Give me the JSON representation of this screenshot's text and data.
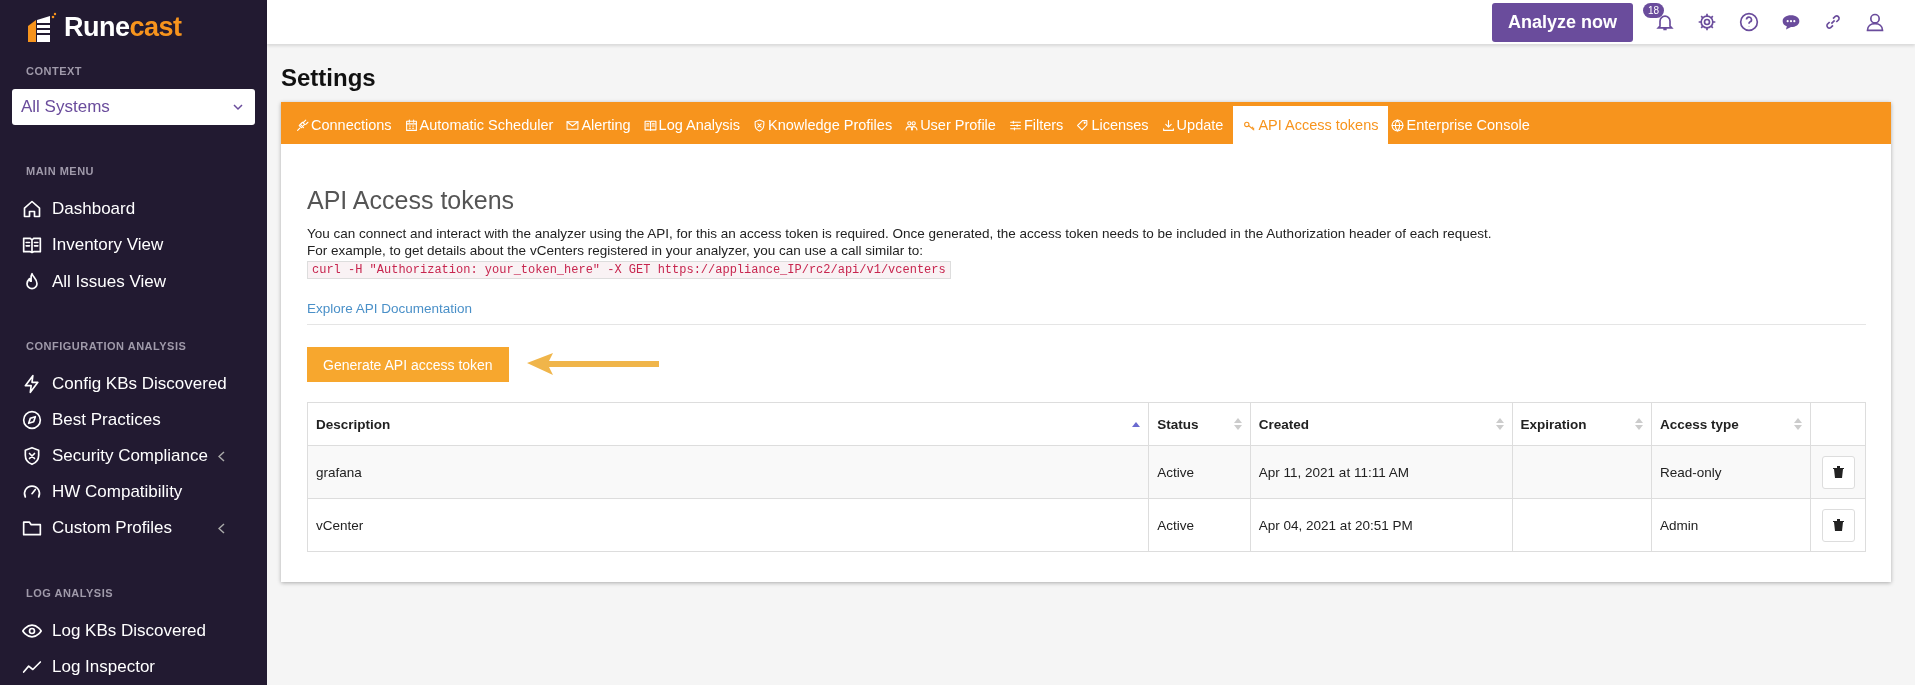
{
  "brand": {
    "name_part1": "Rune",
    "name_part2": "cast"
  },
  "sidebar": {
    "context_label": "CONTEXT",
    "context_select": {
      "value": "All Systems"
    },
    "sections": [
      {
        "heading": "MAIN MENU",
        "items": [
          {
            "label": "Dashboard",
            "expandable": false
          },
          {
            "label": "Inventory View",
            "expandable": false
          },
          {
            "label": "All Issues View",
            "expandable": false
          }
        ]
      },
      {
        "heading": "CONFIGURATION ANALYSIS",
        "items": [
          {
            "label": "Config KBs Discovered",
            "expandable": false
          },
          {
            "label": "Best Practices",
            "expandable": false
          },
          {
            "label": "Security Compliance",
            "expandable": true
          },
          {
            "label": "HW Compatibility",
            "expandable": false
          },
          {
            "label": "Custom Profiles",
            "expandable": true
          }
        ]
      },
      {
        "heading": "LOG ANALYSIS",
        "items": [
          {
            "label": "Log KBs Discovered",
            "expandable": false
          },
          {
            "label": "Log Inspector",
            "expandable": false
          }
        ]
      }
    ]
  },
  "topbar": {
    "analyze_button": "Analyze now",
    "notification_count": "18"
  },
  "page_title": "Settings",
  "tabs": [
    {
      "label": "Connections",
      "selected": false
    },
    {
      "label": "Automatic Scheduler",
      "selected": false
    },
    {
      "label": "Alerting",
      "selected": false
    },
    {
      "label": "Log Analysis",
      "selected": false
    },
    {
      "label": "Knowledge Profiles",
      "selected": false
    },
    {
      "label": "User Profile",
      "selected": false
    },
    {
      "label": "Filters",
      "selected": false
    },
    {
      "label": "Licenses",
      "selected": false
    },
    {
      "label": "Update",
      "selected": false
    },
    {
      "label": "API Access tokens",
      "selected": true
    },
    {
      "label": "Enterprise Console",
      "selected": false
    }
  ],
  "panel": {
    "heading": "API Access tokens",
    "description": "You can connect and interact with the analyzer using the API, for this an access token is required. Once generated, the access token needs to be included in the Authorization header of each request.",
    "example_intro": "For example, to get details about the vCenters registered in your analyzer, you can use a call similar to:",
    "code": "curl -H \"Authorization: your_token_here\" -X GET https://appliance_IP/rc2/api/v1/vcenters",
    "doc_link": "Explore API Documentation",
    "generate_button": "Generate API access token"
  },
  "table": {
    "columns": [
      {
        "label": "Description",
        "sorted": true
      },
      {
        "label": "Status",
        "sorted": false
      },
      {
        "label": "Created",
        "sorted": false
      },
      {
        "label": "Expiration",
        "sorted": false
      },
      {
        "label": "Access type",
        "sorted": false
      }
    ],
    "rows": [
      {
        "cells": [
          "grafana",
          "Active",
          "Apr 11, 2021 at 11:11 AM",
          "",
          "Read-only"
        ]
      },
      {
        "cells": [
          "vCenter",
          "Active",
          "Apr 04, 2021 at 20:51 PM",
          "",
          "Admin"
        ]
      }
    ]
  }
}
